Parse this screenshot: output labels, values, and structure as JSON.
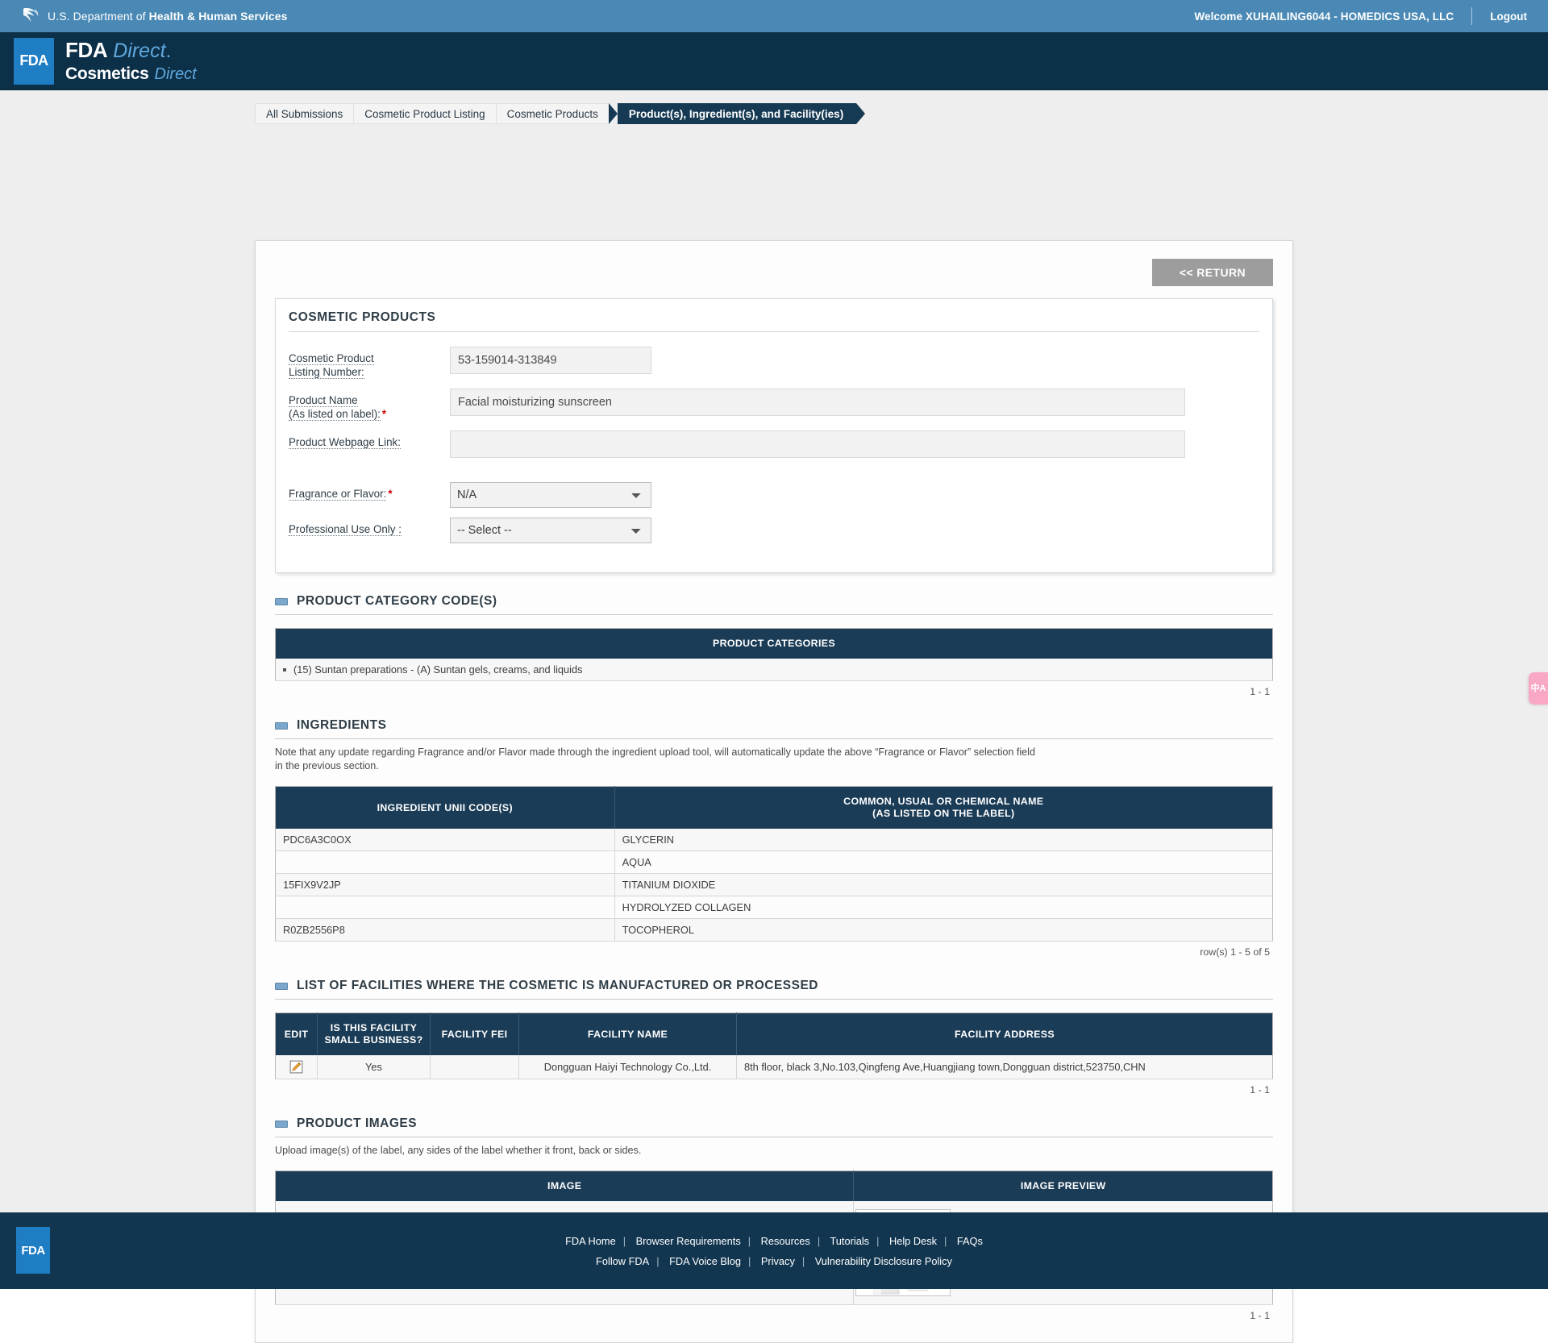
{
  "hhs": {
    "department": "U.S. Department of ",
    "department_bold": "Health & Human Services",
    "welcome": "Welcome XUHAILING6044 - HOMEDICS USA, LLC",
    "logout": "Logout"
  },
  "brand": {
    "badge": "FDA",
    "line1_bold": "FDA",
    "line1_italic": "Direct",
    "line1_dot": ".",
    "line2_bold": "Cosmetics",
    "line2_italic": "Direct"
  },
  "breadcrumbs": [
    {
      "label": "All Submissions",
      "active": false
    },
    {
      "label": "Cosmetic Product Listing",
      "active": false
    },
    {
      "label": "Cosmetic Products",
      "active": false
    },
    {
      "label": "Product(s), Ingredient(s), and Facility(ies)",
      "active": true
    }
  ],
  "toolbar": {
    "return_label": "<< RETURN"
  },
  "product_panel": {
    "title": "COSMETIC PRODUCTS",
    "listing_number_label": "Cosmetic Product",
    "listing_number_label2": "Listing Number:",
    "listing_number_value": "53-159014-313849",
    "product_name_label": "Product Name",
    "product_name_label2": "(As listed on label):",
    "product_name_value": "Facial moisturizing sunscreen",
    "webpage_label": "Product Webpage Link:",
    "webpage_value": "",
    "fragrance_label": "Fragrance or Flavor:",
    "fragrance_value": "N/A",
    "professional_label": "Professional Use Only :",
    "professional_value": "-- Select --"
  },
  "category_section": {
    "title": "PRODUCT CATEGORY CODE(S)",
    "header": "PRODUCT CATEGORIES",
    "rows": [
      "(15) Suntan preparations - (A) Suntan gels, creams, and liquids"
    ],
    "pager": "1 - 1"
  },
  "ingredients_section": {
    "title": "INGREDIENTS",
    "note_line1": "Note that any update regarding Fragrance and/or Flavor made through the ingredient upload tool, will automatically update the above “Fragrance or Flavor” selection field",
    "note_line2": "in the previous section.",
    "col_unii": "INGREDIENT UNII CODE(S)",
    "col_name_line1": "COMMON, USUAL OR CHEMICAL NAME",
    "col_name_line2": "(AS LISTED ON THE LABEL)",
    "rows": [
      {
        "unii": "PDC6A3C0OX",
        "name": "GLYCERIN"
      },
      {
        "unii": "",
        "name": "AQUA"
      },
      {
        "unii": "15FIX9V2JP",
        "name": "TITANIUM DIOXIDE"
      },
      {
        "unii": "",
        "name": "HYDROLYZED COLLAGEN"
      },
      {
        "unii": "R0ZB2556P8",
        "name": "TOCOPHEROL"
      }
    ],
    "pager": "row(s) 1 - 5 of 5"
  },
  "facilities_section": {
    "title": "LIST OF FACILITIES WHERE THE COSMETIC IS MANUFACTURED OR PROCESSED",
    "col_edit": "EDIT",
    "col_small_line1": "IS THIS FACILITY",
    "col_small_line2": "SMALL BUSINESS?",
    "col_fei": "FACILITY FEI",
    "col_name": "FACILITY NAME",
    "col_address": "FACILITY ADDRESS",
    "rows": [
      {
        "small_business": "Yes",
        "fei": "",
        "name": "Dongguan Haiyi Technology Co.,Ltd.",
        "address": "8th floor, black 3,No.103,Qingfeng Ave,Huangjiang town,Dongguan district,523750,CHN"
      }
    ],
    "pager": "1 - 1"
  },
  "images_section": {
    "title": "PRODUCT IMAGES",
    "note": "Upload image(s) of the label, any sides of the label whether it front, back or sides.",
    "col_image": "IMAGE",
    "col_preview": "IMAGE PREVIEW",
    "rows": [
      {
        "filename": "3300F4AE41F9427394711213FE656657.jpg"
      }
    ],
    "pager": "1 - 1"
  },
  "translate_widget": {
    "label": "中A"
  },
  "footer": {
    "badge": "FDA",
    "row1": [
      "FDA Home",
      "Browser Requirements",
      "Resources",
      "Tutorials",
      "Help Desk",
      "FAQs"
    ],
    "row2": [
      "Follow FDA",
      "FDA Voice Blog",
      "Privacy",
      "Vulnerability Disclosure Policy"
    ]
  },
  "colors": {
    "hhs_bar": "#4a89b5",
    "brand_bar": "#0d3049",
    "accent_blue": "#1f7dc4",
    "table_header": "#1b3c57",
    "footer": "#123650",
    "required_red": "#cc0000",
    "link_blue": "#2222cc"
  }
}
